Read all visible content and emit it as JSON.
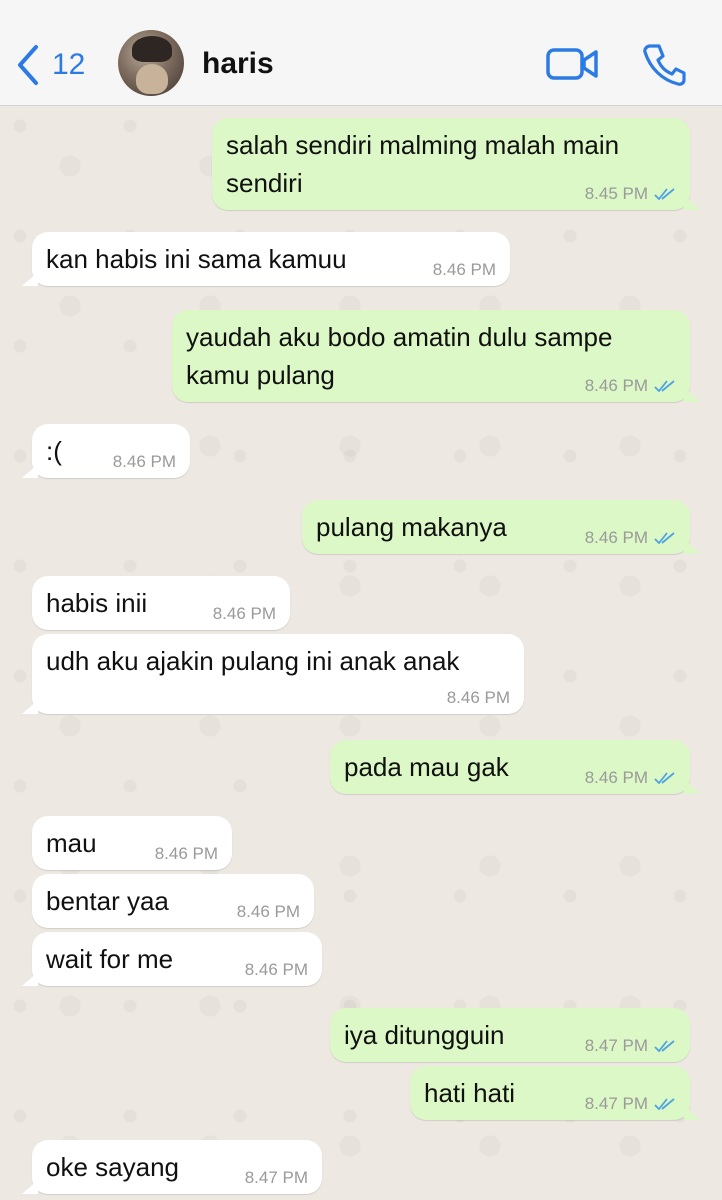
{
  "header": {
    "back_count": "12",
    "contact_name": "haris"
  },
  "colors": {
    "accent": "#2c7be5",
    "incoming_bubble": "#ffffff",
    "outgoing_bubble": "#dcf8c6",
    "read_ticks": "#4fa3e0"
  },
  "messages": [
    {
      "dir": "out",
      "text": "salah sendiri malming malah main\nsendiri",
      "time": "8.45 PM",
      "ticks": "double-check-icon"
    },
    {
      "dir": "in",
      "text": "kan habis ini sama kamuu",
      "time": "8.46 PM"
    },
    {
      "dir": "out",
      "text": "yaudah aku bodo amatin dulu sampe\nkamu pulang",
      "time": "8.46 PM",
      "ticks": "double-check-icon"
    },
    {
      "dir": "in",
      "text": ":(",
      "time": "8.46 PM"
    },
    {
      "dir": "out",
      "text": "pulang makanya",
      "time": "8.46 PM",
      "ticks": "double-check-icon"
    },
    {
      "dir": "in",
      "text": "habis inii",
      "time": "8.46 PM"
    },
    {
      "dir": "in",
      "text": "udh aku ajakin pulang ini anak anak",
      "time": "8.46 PM"
    },
    {
      "dir": "out",
      "text": "pada mau gak",
      "time": "8.46 PM",
      "ticks": "double-check-icon"
    },
    {
      "dir": "in",
      "text": "mau",
      "time": "8.46 PM"
    },
    {
      "dir": "in",
      "text": "bentar yaa",
      "time": "8.46 PM"
    },
    {
      "dir": "in",
      "text": "wait for me",
      "time": "8.46 PM"
    },
    {
      "dir": "out",
      "text": "iya ditungguin",
      "time": "8.47 PM",
      "ticks": "double-check-icon"
    },
    {
      "dir": "out",
      "text": "hati hati",
      "time": "8.47 PM",
      "ticks": "double-check-icon"
    },
    {
      "dir": "in",
      "text": "oke sayang",
      "time": "8.47 PM"
    }
  ]
}
